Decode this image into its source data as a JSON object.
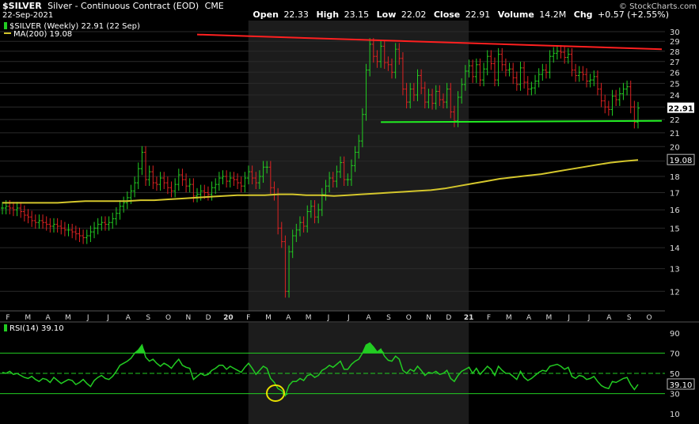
{
  "header": {
    "symbol": "$SILVER",
    "name": "Silver - Continuous Contract (EOD)",
    "exchange": "CME",
    "date": "22-Sep-2021",
    "watermark": "© StockCharts.com",
    "open_label": "Open",
    "open": "22.33",
    "high_label": "High",
    "high": "23.15",
    "low_label": "Low",
    "low": "22.02",
    "close_label": "Close",
    "close": "22.91",
    "volume_label": "Volume",
    "volume": "14.2M",
    "chg_label": "Chg",
    "chg": "+0.57 (+2.55%)"
  },
  "legend": {
    "price_series": "$SILVER (Weekly) 22.91 (22 Sep)",
    "ma_series": "MA(200) 19.08",
    "rsi_series": "RSI(14) 39.10"
  },
  "colors": {
    "up": "#22cc22",
    "down": "#dd2222",
    "ma": "#d4c62c",
    "resistance": "#ff2020",
    "support": "#22ee22",
    "rsi": "#22cc22",
    "shade": "#1c1c1c",
    "grid": "#2a2a2a",
    "axis_text": "#dddddd"
  },
  "chart_data": [
    {
      "type": "ohlc",
      "title": "$SILVER (Weekly) 22.91 (22 Sep)",
      "y_scale": "log",
      "ylim": [
        11.2,
        31.2
      ],
      "y_ticks": [
        12,
        13,
        14,
        15,
        16,
        17,
        18,
        19,
        20,
        21,
        22,
        23,
        24,
        25,
        26,
        27,
        28,
        29,
        30
      ],
      "last_price_label": "22.91",
      "ma_label": "19.08",
      "x_months": [
        "F",
        "M",
        "A",
        "M",
        "J",
        "J",
        "A",
        "S",
        "O",
        "N",
        "D",
        "20",
        "F",
        "M",
        "A",
        "M",
        "J",
        "J",
        "A",
        "S",
        "O",
        "N",
        "D",
        "21",
        "F",
        "M",
        "A",
        "M",
        "J",
        "J",
        "A",
        "S",
        "O"
      ],
      "shaded_month_ranges": [
        [
          12,
          23
        ]
      ],
      "closes": [
        16.1,
        16.2,
        16.1,
        16.0,
        16.1,
        15.9,
        15.7,
        15.6,
        15.4,
        15.3,
        15.4,
        15.3,
        15.2,
        15.1,
        15.2,
        15.1,
        15.0,
        14.9,
        14.9,
        14.8,
        14.7,
        14.6,
        14.5,
        14.6,
        14.8,
        15.0,
        15.2,
        15.3,
        15.2,
        15.3,
        15.5,
        15.8,
        16.2,
        16.4,
        16.7,
        17.1,
        17.6,
        18.5,
        19.6,
        17.8,
        18.3,
        17.6,
        17.5,
        17.9,
        17.6,
        17.3,
        17.1,
        17.5,
        18.1,
        17.8,
        17.4,
        17.5,
        16.8,
        16.9,
        17.1,
        17.0,
        16.9,
        17.3,
        17.5,
        17.9,
        18.0,
        17.7,
        17.9,
        17.8,
        17.6,
        17.4,
        17.9,
        18.3,
        17.9,
        17.6,
        18.0,
        18.6,
        18.6,
        17.3,
        16.9,
        15.0,
        14.3,
        12.0,
        13.8,
        14.6,
        14.9,
        15.3,
        15.1,
        15.9,
        16.2,
        15.6,
        16.0,
        16.9,
        17.4,
        17.9,
        17.7,
        18.3,
        18.9,
        17.8,
        17.8,
        18.7,
        19.6,
        20.4,
        22.4,
        26.2,
        28.7,
        27.5,
        27.0,
        28.5,
        26.9,
        26.7,
        26.0,
        28.2,
        27.3,
        24.5,
        23.4,
        24.5,
        24.0,
        25.7,
        24.6,
        23.4,
        24.0,
        23.3,
        24.3,
        23.6,
        23.4,
        24.5,
        22.6,
        21.9,
        23.8,
        24.9,
        26.1,
        26.6,
        25.6,
        26.7,
        25.3,
        26.3,
        27.5,
        26.8,
        25.3,
        27.7,
        26.7,
        26.2,
        26.3,
        25.5,
        24.9,
        26.4,
        25.1,
        24.5,
        24.6,
        25.2,
        25.8,
        26.2,
        26.0,
        27.5,
        27.8,
        28.0,
        27.9,
        27.4,
        27.7,
        26.2,
        25.7,
        26.0,
        25.8,
        25.2,
        25.3,
        25.6,
        24.5,
        23.5,
        23.0,
        22.8,
        23.9,
        23.6,
        24.1,
        24.5,
        24.7,
        23.0,
        21.8,
        22.91
      ],
      "ma200": [
        16.4,
        16.4,
        16.4,
        16.4,
        16.4,
        16.45,
        16.5,
        16.5,
        16.5,
        16.5,
        16.55,
        16.55,
        16.6,
        16.65,
        16.7,
        16.75,
        16.8,
        16.85,
        16.85,
        16.85,
        16.9,
        16.9,
        16.85,
        16.85,
        16.8,
        16.85,
        16.9,
        16.95,
        17.0,
        17.05,
        17.1,
        17.15,
        17.25,
        17.4,
        17.55,
        17.7,
        17.85,
        17.95,
        18.05,
        18.15,
        18.3,
        18.45,
        18.6,
        18.75,
        18.9,
        19.0,
        19.08
      ],
      "ma_start_week": 0,
      "resistance_line": {
        "from": [
          53,
          29.7
        ],
        "to": [
          180,
          28.2
        ]
      },
      "support_line": {
        "from": [
          103,
          21.8
        ],
        "to": [
          183,
          21.9
        ]
      }
    },
    {
      "type": "line",
      "title": "RSI(14) 39.10",
      "ylim": [
        0,
        100
      ],
      "y_ticks": [
        10,
        30,
        50,
        70,
        90
      ],
      "reference_lines": [
        30,
        50,
        70
      ],
      "last_value_label": "39.10",
      "values": [
        51,
        50,
        52,
        49,
        50,
        48,
        46,
        45,
        47,
        44,
        42,
        45,
        44,
        41,
        46,
        43,
        40,
        42,
        44,
        43,
        39,
        41,
        44,
        40,
        37,
        43,
        46,
        48,
        45,
        44,
        47,
        52,
        58,
        60,
        62,
        65,
        70,
        73,
        78,
        66,
        62,
        64,
        60,
        57,
        60,
        58,
        55,
        60,
        64,
        58,
        56,
        55,
        44,
        47,
        50,
        48,
        49,
        53,
        55,
        58,
        58,
        54,
        57,
        55,
        53,
        51,
        56,
        60,
        55,
        49,
        53,
        57,
        55,
        45,
        41,
        35,
        33,
        28,
        38,
        42,
        42,
        45,
        43,
        48,
        49,
        46,
        48,
        53,
        55,
        58,
        56,
        59,
        62,
        54,
        54,
        59,
        62,
        64,
        70,
        78,
        80,
        76,
        71,
        74,
        67,
        63,
        62,
        67,
        64,
        53,
        50,
        54,
        52,
        57,
        53,
        48,
        51,
        50,
        52,
        49,
        50,
        53,
        45,
        42,
        48,
        52,
        54,
        56,
        50,
        55,
        49,
        53,
        57,
        54,
        48,
        57,
        53,
        50,
        50,
        47,
        44,
        52,
        46,
        43,
        45,
        48,
        51,
        53,
        52,
        57,
        58,
        59,
        57,
        54,
        56,
        47,
        45,
        48,
        47,
        44,
        45,
        47,
        42,
        38,
        36,
        35,
        42,
        41,
        43,
        45,
        46,
        39,
        34,
        39.1
      ]
    }
  ]
}
